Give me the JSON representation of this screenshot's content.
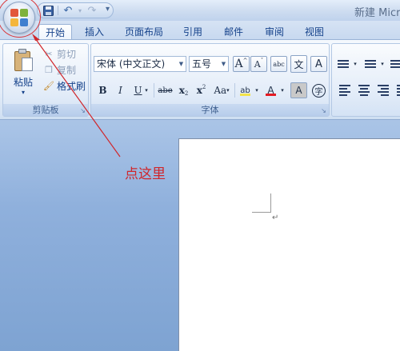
{
  "title": {
    "text": "新建 Micr"
  },
  "quick_access": {
    "save_icon": "save-icon",
    "undo_icon": "undo-icon",
    "redo_icon": "redo-icon",
    "more_icon": "▾"
  },
  "tabs": [
    "开始",
    "插入",
    "页面布局",
    "引用",
    "邮件",
    "审阅",
    "视图"
  ],
  "active_tab": "开始",
  "clipboard": {
    "paste_label": "粘贴",
    "paste_arrow": "▾",
    "cut_label": "剪切",
    "copy_label": "复制",
    "format_painter_label": "格式刷",
    "group_label": "剪贴板"
  },
  "font": {
    "font_name": "宋体 (中文正文)",
    "font_size": "五号",
    "grow_label": "A",
    "shrink_label": "A",
    "phonetic_label": "abc",
    "char_border_label": "A",
    "enclose_label": "字",
    "wen_label": "文",
    "bold": "B",
    "italic": "I",
    "underline": "U",
    "strike": "abe",
    "subscript_base": "x",
    "subscript_mark": "2",
    "superscript_base": "x",
    "superscript_mark": "2",
    "change_case": "Aa",
    "highlight_label": "ab",
    "font_color_label": "A",
    "char_shading_label": "A",
    "group_label": "字体"
  },
  "colors": {
    "annotation": "#d0262b",
    "highlight": "#f3e34a",
    "font_color": "#e31b23",
    "office_logo": [
      "#e2573c",
      "#7fb23c",
      "#f4b63c",
      "#3f7fcf"
    ]
  },
  "annotation": {
    "text": "点这里"
  },
  "document": {
    "paragraph_mark": "↵"
  }
}
